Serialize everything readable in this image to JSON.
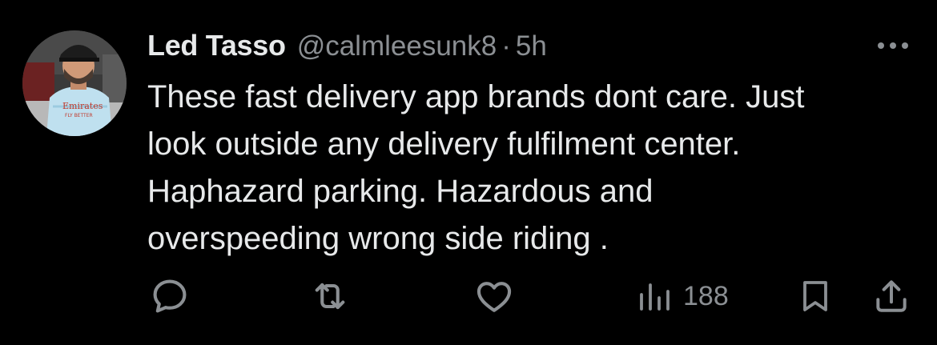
{
  "tweet": {
    "display_name": "Led Tasso",
    "handle": "@calmleesunk8",
    "separator": "·",
    "time": "5h",
    "text_lines": [
      "These fast delivery app brands dont care. Just",
      "look outside any delivery fulfilment center.",
      "Haphazard parking. Hazardous and",
      "overspeeding wrong side riding ."
    ],
    "avatar_shirt_text": [
      "Emirates",
      "FLY BETTER"
    ]
  },
  "actions": {
    "reply_icon": "reply-icon",
    "retweet_icon": "retweet-icon",
    "like_icon": "like-icon",
    "views_icon": "views-icon",
    "views_count": "188",
    "bookmark_icon": "bookmark-icon",
    "share_icon": "share-icon"
  },
  "colors": {
    "background": "#000000",
    "primary_text": "#e7e9ea",
    "secondary_text": "#8b8f93"
  }
}
